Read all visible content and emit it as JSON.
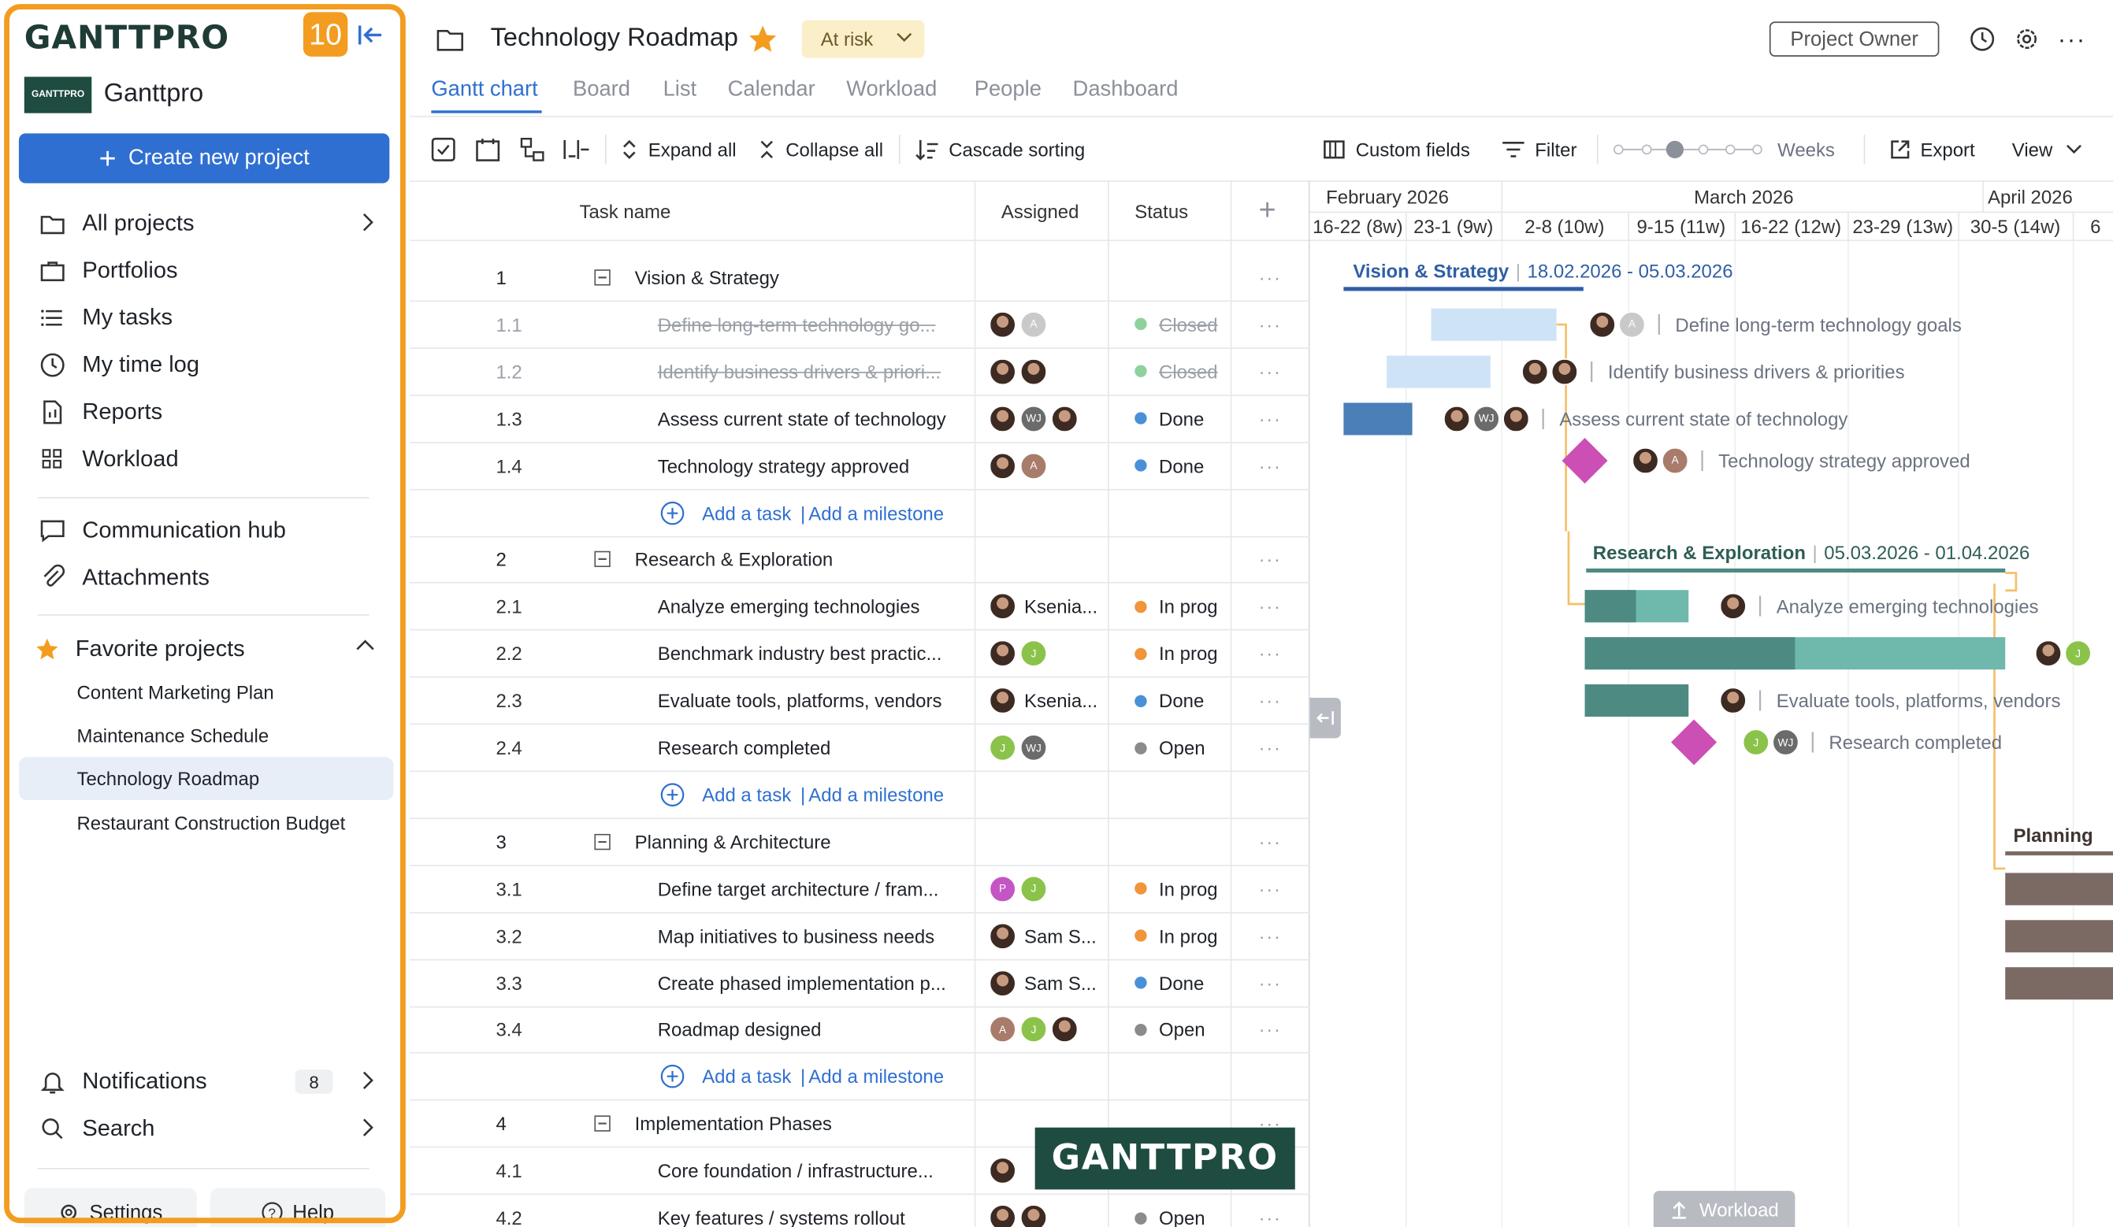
{
  "sidebar": {
    "logo": "GANTTPRO",
    "badge_count": "10",
    "workspace": "Ganttpro",
    "workspace_logo": "GANTTPRO",
    "create_button": "Create new project",
    "nav": [
      {
        "label": "All projects",
        "icon": "folder-icon"
      },
      {
        "label": "Portfolios",
        "icon": "briefcase-icon"
      },
      {
        "label": "My tasks",
        "icon": "list-icon"
      },
      {
        "label": "My time log",
        "icon": "clock-icon"
      },
      {
        "label": "Reports",
        "icon": "report-icon"
      },
      {
        "label": "Workload",
        "icon": "grid-icon"
      },
      {
        "label": "Communication hub",
        "icon": "chat-icon"
      },
      {
        "label": "Attachments",
        "icon": "paperclip-icon"
      }
    ],
    "favorites_label": "Favorite projects",
    "favorites": [
      "Content Marketing Plan",
      "Maintenance Schedule",
      "Technology Roadmap",
      "Restaurant Construction Budget"
    ],
    "notifications_label": "Notifications",
    "notifications_count": "8",
    "search_label": "Search",
    "settings_label": "Settings",
    "help_label": "Help"
  },
  "header": {
    "project_title": "Technology Roadmap",
    "status": "At risk",
    "role": "Project Owner",
    "tabs": [
      "Gantt chart",
      "Board",
      "List",
      "Calendar",
      "Workload",
      "People",
      "Dashboard"
    ],
    "active_tab": "Gantt chart"
  },
  "toolbar": {
    "expand_all": "Expand all",
    "collapse_all": "Collapse all",
    "cascade_sorting": "Cascade sorting",
    "custom_fields": "Custom fields",
    "filter": "Filter",
    "zoom_label": "Weeks",
    "zoom_level": 0.45,
    "export": "Export",
    "view": "View"
  },
  "grid": {
    "columns": {
      "task_name": "Task name",
      "assigned": "Assigned",
      "status": "Status"
    },
    "add_task": "Add a task",
    "add_milestone": "Add a milestone",
    "rows": [
      {
        "kind": "group",
        "num": "1",
        "name": "Vision & Strategy"
      },
      {
        "kind": "task",
        "num": "1.1",
        "name": "Define long-term technology go...",
        "assignees": [
          {
            "type": "photo"
          },
          {
            "type": "initials",
            "text": "A",
            "color": "#c9c9c9"
          }
        ],
        "status": "Closed",
        "status_color": "#8fd19e",
        "closed": true
      },
      {
        "kind": "task",
        "num": "1.2",
        "name": "Identify business drivers & priori...",
        "assignees": [
          {
            "type": "photo"
          },
          {
            "type": "photo"
          }
        ],
        "status": "Closed",
        "status_color": "#8fd19e",
        "closed": true
      },
      {
        "kind": "task",
        "num": "1.3",
        "name": "Assess current state of technology",
        "assignees": [
          {
            "type": "photo"
          },
          {
            "type": "initials",
            "text": "WJ",
            "color": "#6b6b6b"
          },
          {
            "type": "photo"
          }
        ],
        "status": "Done",
        "status_color": "#4a90d9"
      },
      {
        "kind": "task",
        "num": "1.4",
        "name": "Technology strategy approved",
        "assignees": [
          {
            "type": "photo"
          },
          {
            "type": "initials",
            "text": "A",
            "color": "#a87b6b"
          }
        ],
        "status": "Done",
        "status_color": "#4a90d9"
      },
      {
        "kind": "add"
      },
      {
        "kind": "group",
        "num": "2",
        "name": "Research & Exploration"
      },
      {
        "kind": "task",
        "num": "2.1",
        "name": "Analyze emerging technologies",
        "assignees": [
          {
            "type": "photo"
          }
        ],
        "assignee_name": "Ksenia...",
        "status": "In prog",
        "status_color": "#f0953a"
      },
      {
        "kind": "task",
        "num": "2.2",
        "name": "Benchmark industry best practic...",
        "assignees": [
          {
            "type": "photo"
          },
          {
            "type": "initials",
            "text": "J",
            "color": "#8bc34a"
          }
        ],
        "status": "In prog",
        "status_color": "#f0953a"
      },
      {
        "kind": "task",
        "num": "2.3",
        "name": "Evaluate tools, platforms, vendors",
        "assignees": [
          {
            "type": "photo"
          }
        ],
        "assignee_name": "Ksenia...",
        "status": "Done",
        "status_color": "#4a90d9"
      },
      {
        "kind": "task",
        "num": "2.4",
        "name": "Research completed",
        "assignees": [
          {
            "type": "initials",
            "text": "J",
            "color": "#8bc34a"
          },
          {
            "type": "initials",
            "text": "WJ",
            "color": "#6b6b6b"
          }
        ],
        "status": "Open",
        "status_color": "#8b8b8b"
      },
      {
        "kind": "add"
      },
      {
        "kind": "group",
        "num": "3",
        "name": "Planning & Architecture"
      },
      {
        "kind": "task",
        "num": "3.1",
        "name": "Define target architecture / fram...",
        "assignees": [
          {
            "type": "initials",
            "text": "P",
            "color": "#c455c4"
          },
          {
            "type": "initials",
            "text": "J",
            "color": "#8bc34a"
          }
        ],
        "status": "In prog",
        "status_color": "#f0953a"
      },
      {
        "kind": "task",
        "num": "3.2",
        "name": "Map initiatives to business needs",
        "assignees": [
          {
            "type": "photo"
          }
        ],
        "assignee_name": "Sam S...",
        "status": "In prog",
        "status_color": "#f0953a"
      },
      {
        "kind": "task",
        "num": "3.3",
        "name": "Create phased implementation p...",
        "assignees": [
          {
            "type": "photo"
          }
        ],
        "assignee_name": "Sam S...",
        "status": "Done",
        "status_color": "#4a90d9"
      },
      {
        "kind": "task",
        "num": "3.4",
        "name": "Roadmap designed",
        "assignees": [
          {
            "type": "initials",
            "text": "A",
            "color": "#a87b6b"
          },
          {
            "type": "initials",
            "text": "J",
            "color": "#8bc34a"
          },
          {
            "type": "photo"
          }
        ],
        "status": "Open",
        "status_color": "#8b8b8b"
      },
      {
        "kind": "add"
      },
      {
        "kind": "group",
        "num": "4",
        "name": "Implementation Phases"
      },
      {
        "kind": "task",
        "num": "4.1",
        "name": "Core foundation / infrastructure...",
        "assignees": [
          {
            "type": "photo"
          }
        ],
        "status": "",
        "status_color": ""
      },
      {
        "kind": "task",
        "num": "4.2",
        "name": "Key features / systems rollout",
        "assignees": [
          {
            "type": "photo"
          },
          {
            "type": "photo"
          }
        ],
        "status": "Open",
        "status_color": "#8b8b8b"
      }
    ]
  },
  "timeline": {
    "months": [
      "February 2026",
      "March 2026",
      "April 2026"
    ],
    "weeks": [
      "16-22 (8w)",
      "23-1 (9w)",
      "2-8 (10w)",
      "9-15 (11w)",
      "16-22 (12w)",
      "23-29 (13w)",
      "30-5 (14w)",
      "6"
    ],
    "groups": [
      {
        "name": "Vision & Strategy",
        "dates": "18.02.2026 - 05.03.2026"
      },
      {
        "name": "Research & Exploration",
        "dates": "05.03.2026 - 01.04.2026"
      },
      {
        "name": "Planning"
      }
    ],
    "task_labels": [
      "Define long-term technology goals",
      "Identify business drivers & priorities",
      "Assess current state of technology",
      "Technology strategy approved",
      "Analyze emerging technologies",
      "Evaluate tools, platforms, vendors",
      "Research completed"
    ],
    "workload_button": "Workload",
    "watermark": "GANTTPRO",
    "colors": {
      "accent": "#2f6fd1",
      "sidebar_highlight": "#f39c1f",
      "milestone": "#cc4fb5",
      "bar_blue": "#4a7fb8",
      "bar_light_blue": "#cfe3f7",
      "bar_teal": "#4d8a82",
      "bar_teal_light": "#6fb8ac",
      "bar_brown": "#7a6a63",
      "dependency": "#f5c06a"
    }
  }
}
